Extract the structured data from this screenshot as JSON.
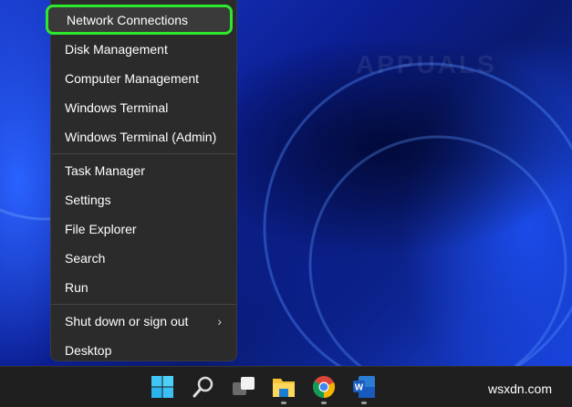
{
  "menu": {
    "items": [
      {
        "label": "Network Connections",
        "highlighted": true
      },
      {
        "label": "Disk Management"
      },
      {
        "label": "Computer Management"
      },
      {
        "label": "Windows Terminal"
      },
      {
        "label": "Windows Terminal (Admin)"
      },
      {
        "label": "Task Manager"
      },
      {
        "label": "Settings"
      },
      {
        "label": "File Explorer"
      },
      {
        "label": "Search"
      },
      {
        "label": "Run"
      },
      {
        "label": "Shut down or sign out",
        "submenu": true
      },
      {
        "label": "Desktop"
      }
    ],
    "highlight_color": "#2ee82e"
  },
  "watermark": "APPUALS",
  "taskbar": {
    "icons": [
      "windows-start-icon",
      "search-icon",
      "task-view-icon",
      "file-explorer-icon",
      "chrome-icon",
      "word-icon"
    ]
  },
  "site_label": "wsxdn.com"
}
